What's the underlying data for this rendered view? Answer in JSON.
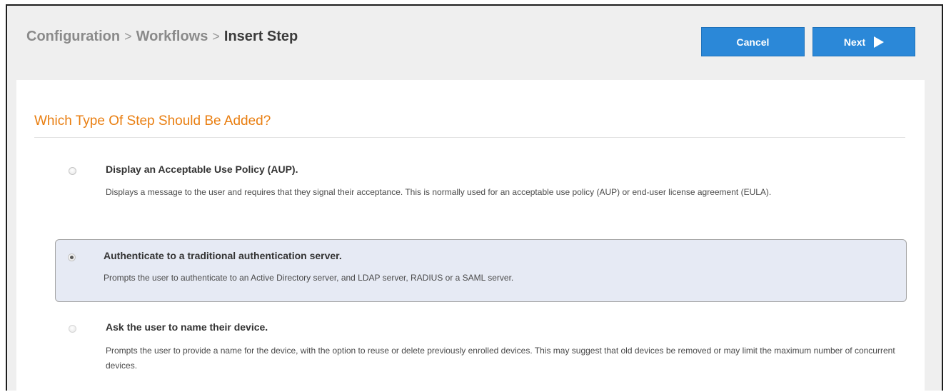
{
  "breadcrumb": {
    "items": [
      "Configuration",
      "Workflows"
    ],
    "separator": ">",
    "current": "Insert Step"
  },
  "toolbar": {
    "cancel_label": "Cancel",
    "next_label": "Next"
  },
  "panel": {
    "title": "Which Type Of Step Should Be Added?"
  },
  "options": [
    {
      "title": "Display an Acceptable Use Policy (AUP).",
      "description": "Displays a message to the user and requires that they signal their acceptance. This is normally used for an acceptable use policy (AUP) or end-user license agreement (EULA).",
      "selected": false
    },
    {
      "title": "Authenticate to a traditional authentication server.",
      "description": "Prompts the user to authenticate to an Active Directory server, and LDAP server, RADIUS or a SAML server.",
      "selected": true
    },
    {
      "title": "Ask the user to name their device.",
      "description": "Prompts the user to provide a name for the device, with the option to reuse or delete previously enrolled devices. This may suggest that old devices be removed or may limit the maximum number of concurrent devices.",
      "selected": false
    }
  ],
  "colors": {
    "accent_button": "#2b88d8",
    "title_orange": "#e97e10",
    "selected_bg": "#e6eaf4"
  }
}
